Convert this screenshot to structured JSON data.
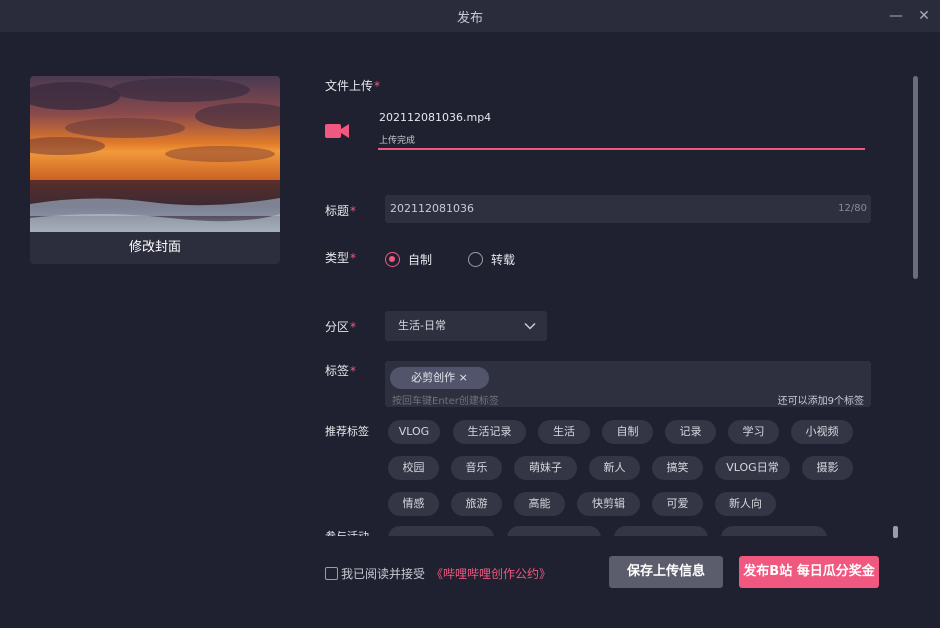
{
  "window": {
    "title": "发布",
    "min_glyph": "—",
    "close_glyph": "✕"
  },
  "cover": {
    "button_label": "修改封面"
  },
  "upload": {
    "label": "文件上传",
    "required_mark": "*",
    "file_name": "202112081036.mp4",
    "status": "上传完成",
    "progress": 1.0,
    "icon": "video-camera-icon"
  },
  "title_field": {
    "label": "标题",
    "required_mark": "*",
    "value": "202112081036",
    "count": "12/80"
  },
  "type_field": {
    "label": "类型",
    "required_mark": "*",
    "options": [
      {
        "label": "自制",
        "selected": true
      },
      {
        "label": "转载",
        "selected": false
      }
    ]
  },
  "section_field": {
    "label": "分区",
    "required_mark": "*",
    "value": "生活-日常",
    "icon": "chevron-down-icon"
  },
  "tags_field": {
    "label": "标签",
    "required_mark": "*",
    "chips": [
      "必剪创作 ×"
    ],
    "placeholder": "按回车键Enter创建标签",
    "remaining": "还可以添加9个标签"
  },
  "recommended": {
    "label": "推荐标签",
    "rows": [
      [
        "VLOG",
        "生活记录",
        "生活",
        "自制",
        "记录",
        "学习",
        "小视频"
      ],
      [
        "校园",
        "音乐",
        "萌妹子",
        "新人",
        "搞笑",
        "VLOG日常",
        "摄影"
      ],
      [
        "情感",
        "旅游",
        "高能",
        "快剪辑",
        "可爱",
        "新人向"
      ]
    ]
  },
  "activity": {
    "label": "参与活动"
  },
  "footer": {
    "agree_text": "我已阅读并接受",
    "agree_link": "《哔哩哔哩创作公约》",
    "save_label": "保存上传信息",
    "publish_label": "发布B站 每日瓜分奖金"
  },
  "colors": {
    "accent": "#f0587f",
    "background": "#1f2130",
    "panel": "#2e3040"
  }
}
